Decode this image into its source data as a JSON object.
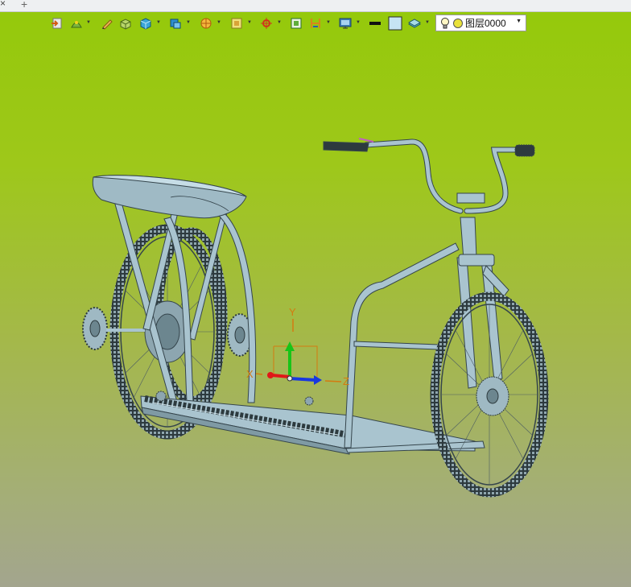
{
  "tabbar": {
    "close_glyph": "×",
    "add_glyph": "+"
  },
  "toolbar": {
    "buttons": [
      {
        "name": "import-icon",
        "has_menu": false
      },
      {
        "name": "render-mode-icon",
        "has_menu": true
      },
      {
        "name": "pencil-icon",
        "has_menu": false
      },
      {
        "name": "solid-shade-icon",
        "has_menu": false
      },
      {
        "name": "cube-icon",
        "has_menu": true
      },
      {
        "name": "view-orientation-icon",
        "has_menu": true
      },
      {
        "name": "section-view-icon",
        "has_menu": true
      },
      {
        "name": "display-style-icon",
        "has_menu": true
      },
      {
        "name": "origin-axes-icon",
        "has_menu": true
      },
      {
        "name": "fit-view-icon",
        "has_menu": false
      },
      {
        "name": "layer-filter-icon",
        "has_menu": true
      },
      {
        "name": "monitor-icon",
        "has_menu": true
      },
      {
        "name": "line-color-icon",
        "has_menu": false
      },
      {
        "name": "fill-color-icon",
        "has_menu": false
      },
      {
        "name": "layers-stack-icon",
        "has_menu": true
      }
    ],
    "layer_select": {
      "value": "图层0000",
      "bulb_icon": "lightbulb-icon",
      "status_icon": "layer-color-dot-icon"
    }
  },
  "triad": {
    "x_label": "X",
    "y_label": "Y",
    "z_label": "Z",
    "colors": {
      "x": "#e01818",
      "y": "#18c418",
      "z": "#1838e0",
      "handle": "#d47a10"
    }
  },
  "colors": {
    "model": "#a9c4cf",
    "model_edge": "#35454c",
    "background_top": "#94c90a",
    "background_bottom": "#a3a58e"
  }
}
